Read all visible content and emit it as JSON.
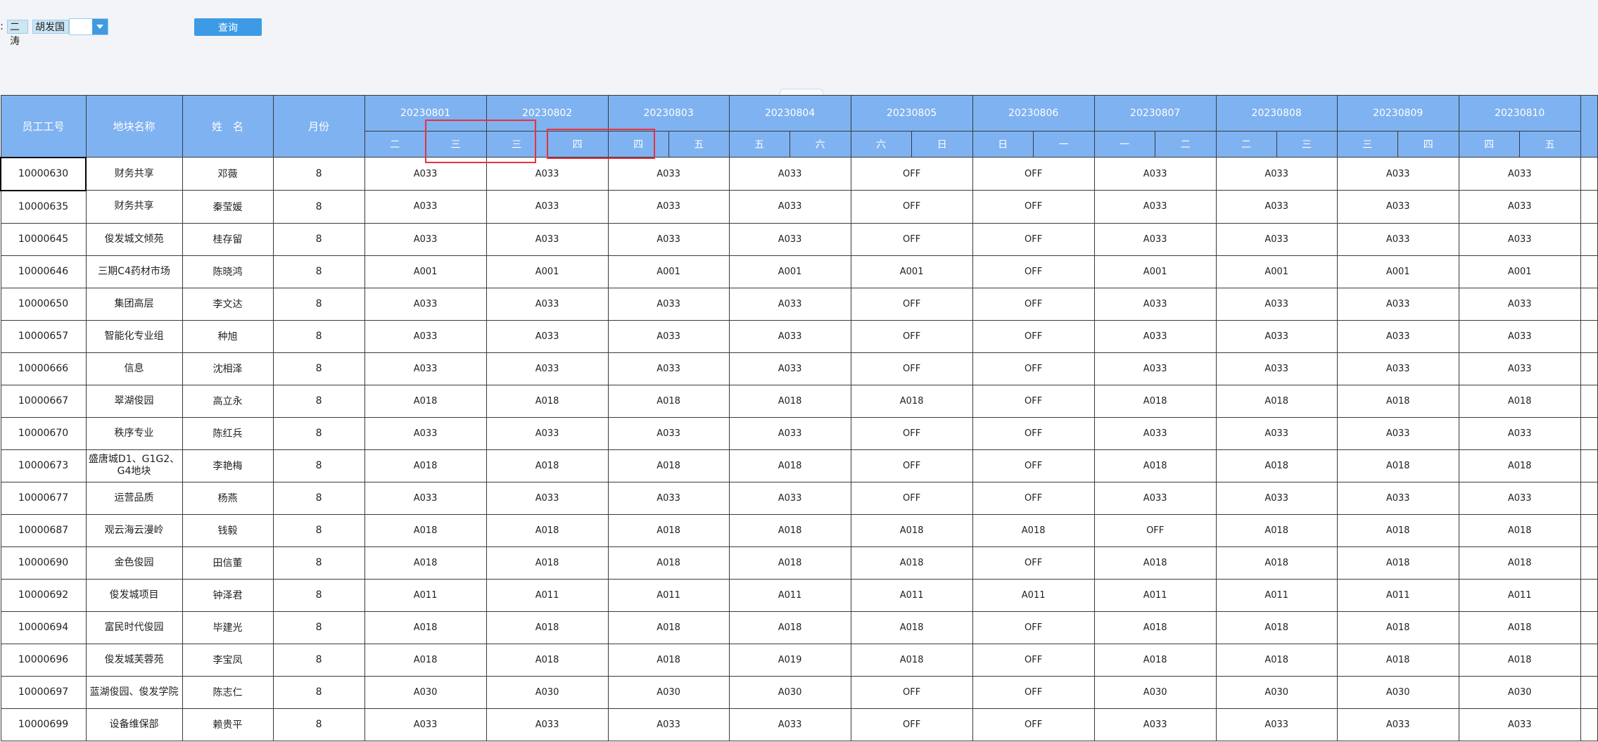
{
  "filter": {
    "colon": ":",
    "selected_tags": [
      "二涛",
      "胡发国"
    ],
    "query_label": "查询"
  },
  "table": {
    "fixed_headers": [
      "员工工号",
      "地块名称",
      "姓　名",
      "月份"
    ],
    "dates": [
      "20230801",
      "20230802",
      "20230803",
      "20230804",
      "20230805",
      "20230806",
      "20230807",
      "20230808",
      "20230809",
      "20230810"
    ],
    "weekdays": [
      "二",
      "三",
      "三",
      "四",
      "四",
      "五",
      "五",
      "六",
      "六",
      "日",
      "日",
      "一",
      "一",
      "二",
      "二",
      "三",
      "三",
      "四",
      "四",
      "五"
    ],
    "rows": [
      {
        "id": "10000630",
        "site": "财务共享",
        "name": "邓薇",
        "month": "8",
        "shifts": [
          "A033",
          "A033",
          "A033",
          "A033",
          "OFF",
          "OFF",
          "A033",
          "A033",
          "A033",
          "A033"
        ]
      },
      {
        "id": "10000635",
        "site": "财务共享",
        "name": "秦莹媛",
        "month": "8",
        "shifts": [
          "A033",
          "A033",
          "A033",
          "A033",
          "OFF",
          "OFF",
          "A033",
          "A033",
          "A033",
          "A033"
        ]
      },
      {
        "id": "10000645",
        "site": "俊发城文倾苑",
        "name": "桂存留",
        "month": "8",
        "shifts": [
          "A033",
          "A033",
          "A033",
          "A033",
          "OFF",
          "OFF",
          "A033",
          "A033",
          "A033",
          "A033"
        ]
      },
      {
        "id": "10000646",
        "site": "三期C4药材市场",
        "name": "陈晓鸿",
        "month": "8",
        "shifts": [
          "A001",
          "A001",
          "A001",
          "A001",
          "A001",
          "OFF",
          "A001",
          "A001",
          "A001",
          "A001"
        ]
      },
      {
        "id": "10000650",
        "site": "集团高层",
        "name": "李文达",
        "month": "8",
        "shifts": [
          "A033",
          "A033",
          "A033",
          "A033",
          "OFF",
          "OFF",
          "A033",
          "A033",
          "A033",
          "A033"
        ]
      },
      {
        "id": "10000657",
        "site": "智能化专业组",
        "name": "种旭",
        "month": "8",
        "shifts": [
          "A033",
          "A033",
          "A033",
          "A033",
          "OFF",
          "OFF",
          "A033",
          "A033",
          "A033",
          "A033"
        ]
      },
      {
        "id": "10000666",
        "site": "信息",
        "name": "沈相泽",
        "month": "8",
        "shifts": [
          "A033",
          "A033",
          "A033",
          "A033",
          "OFF",
          "OFF",
          "A033",
          "A033",
          "A033",
          "A033"
        ]
      },
      {
        "id": "10000667",
        "site": "翠湖俊园",
        "name": "高立永",
        "month": "8",
        "shifts": [
          "A018",
          "A018",
          "A018",
          "A018",
          "A018",
          "OFF",
          "A018",
          "A018",
          "A018",
          "A018"
        ]
      },
      {
        "id": "10000670",
        "site": "秩序专业",
        "name": "陈红兵",
        "month": "8",
        "shifts": [
          "A033",
          "A033",
          "A033",
          "A033",
          "OFF",
          "OFF",
          "A033",
          "A033",
          "A033",
          "A033"
        ]
      },
      {
        "id": "10000673",
        "site": "盛唐城D1、G1G2、G4地块",
        "name": "李艳梅",
        "month": "8",
        "shifts": [
          "A018",
          "A018",
          "A018",
          "A018",
          "OFF",
          "OFF",
          "A018",
          "A018",
          "A018",
          "A018"
        ]
      },
      {
        "id": "10000677",
        "site": "运营品质",
        "name": "杨燕",
        "month": "8",
        "shifts": [
          "A033",
          "A033",
          "A033",
          "A033",
          "OFF",
          "OFF",
          "A033",
          "A033",
          "A033",
          "A033"
        ]
      },
      {
        "id": "10000687",
        "site": "观云海云漫岭",
        "name": "钱毅",
        "month": "8",
        "shifts": [
          "A018",
          "A018",
          "A018",
          "A018",
          "A018",
          "A018",
          "OFF",
          "A018",
          "A018",
          "A018"
        ]
      },
      {
        "id": "10000690",
        "site": "金色俊园",
        "name": "田信董",
        "month": "8",
        "shifts": [
          "A018",
          "A018",
          "A018",
          "A018",
          "A018",
          "OFF",
          "A018",
          "A018",
          "A018",
          "A018"
        ]
      },
      {
        "id": "10000692",
        "site": "俊发城项目",
        "name": "钟泽君",
        "month": "8",
        "shifts": [
          "A011",
          "A011",
          "A011",
          "A011",
          "A011",
          "A011",
          "A011",
          "A011",
          "A011",
          "A011"
        ]
      },
      {
        "id": "10000694",
        "site": "富民时代俊园",
        "name": "毕建光",
        "month": "8",
        "shifts": [
          "A018",
          "A018",
          "A018",
          "A018",
          "A018",
          "OFF",
          "A018",
          "A018",
          "A018",
          "A018"
        ]
      },
      {
        "id": "10000696",
        "site": "俊发城芙蓉苑",
        "name": "李宝凤",
        "month": "8",
        "shifts": [
          "A018",
          "A018",
          "A018",
          "A019",
          "A018",
          "OFF",
          "A018",
          "A018",
          "A018",
          "A018"
        ]
      },
      {
        "id": "10000697",
        "site": "蓝湖俊园、俊发学院",
        "name": "陈志仁",
        "month": "8",
        "shifts": [
          "A030",
          "A030",
          "A030",
          "A030",
          "OFF",
          "OFF",
          "A030",
          "A030",
          "A030",
          "A030"
        ]
      },
      {
        "id": "10000699",
        "site": "设备维保部",
        "name": "赖贵平",
        "month": "8",
        "shifts": [
          "A033",
          "A033",
          "A033",
          "A033",
          "OFF",
          "OFF",
          "A033",
          "A033",
          "A033",
          "A033"
        ]
      }
    ]
  },
  "colors": {
    "header_bg": "#7fb2f1",
    "button_bg": "#3d9be5",
    "highlight_border": "#e8323a"
  }
}
